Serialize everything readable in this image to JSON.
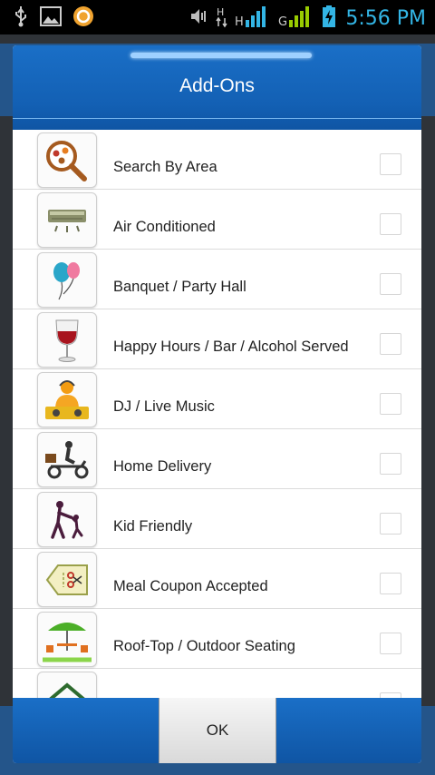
{
  "statusbar": {
    "time": "5:56 PM",
    "icons": [
      "usb-icon",
      "gallery-icon",
      "app-notification-icon",
      "mute-icon",
      "hsdpa-data-icon",
      "signal-sim1-icon",
      "signal-sim2-icon",
      "battery-charging-icon"
    ],
    "sim1_type": "H",
    "sim2_type": "G"
  },
  "dialog": {
    "title": "Add-Ons",
    "ok_label": "OK",
    "accent": "#1566bf"
  },
  "addons": [
    {
      "label": "Search By Area",
      "icon": "search-by-area-icon",
      "checked": false
    },
    {
      "label": "Air Conditioned",
      "icon": "air-conditioner-icon",
      "checked": false
    },
    {
      "label": "Banquet / Party Hall",
      "icon": "balloons-icon",
      "checked": false
    },
    {
      "label": "Happy Hours / Bar / Alcohol Served",
      "icon": "wine-glass-icon",
      "checked": false
    },
    {
      "label": "DJ / Live Music",
      "icon": "dj-icon",
      "checked": false
    },
    {
      "label": "Home Delivery",
      "icon": "delivery-scooter-icon",
      "checked": false
    },
    {
      "label": "Kid Friendly",
      "icon": "parent-child-icon",
      "checked": false
    },
    {
      "label": "Meal Coupon Accepted",
      "icon": "coupon-icon",
      "checked": false
    },
    {
      "label": "Roof-Top / Outdoor Seating",
      "icon": "outdoor-seating-icon",
      "checked": false
    },
    {
      "label": "",
      "icon": "house-icon",
      "checked": false
    }
  ]
}
